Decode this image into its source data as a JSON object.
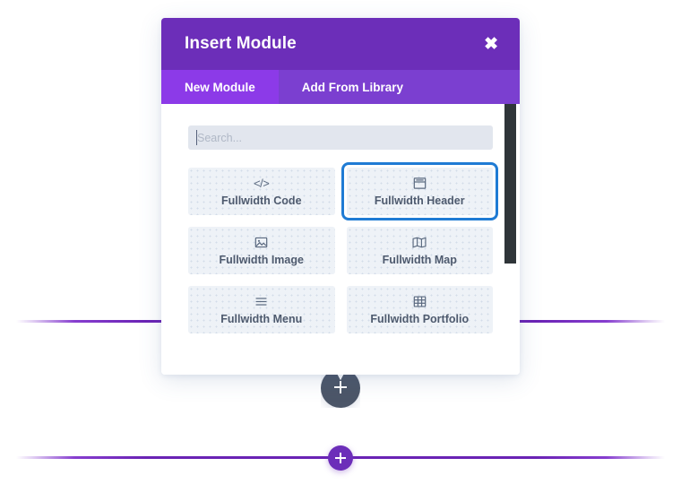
{
  "modal": {
    "title": "Insert Module",
    "close_icon": "close-icon",
    "close_glyph": "✖",
    "tabs": [
      {
        "label": "New Module",
        "active": true
      },
      {
        "label": "Add From Library",
        "active": false
      }
    ],
    "search": {
      "placeholder": "Search...",
      "value": ""
    },
    "modules": [
      {
        "label": "Fullwidth Code",
        "icon": "code-icon",
        "selected": false
      },
      {
        "label": "Fullwidth Header",
        "icon": "header-icon",
        "selected": true
      },
      {
        "label": "Fullwidth Image",
        "icon": "image-icon",
        "selected": false
      },
      {
        "label": "Fullwidth Map",
        "icon": "map-icon",
        "selected": false
      },
      {
        "label": "Fullwidth Menu",
        "icon": "menu-icon",
        "selected": false
      },
      {
        "label": "Fullwidth Portfolio",
        "icon": "portfolio-icon",
        "selected": false
      }
    ],
    "scrollbar": {
      "name": "modal-scrollbar"
    }
  },
  "canvas": {
    "section_toggle": {
      "icon": "plus-icon"
    },
    "add_section_button": {
      "icon": "plus-icon"
    }
  },
  "colors": {
    "header_purple": "#6c2eb9",
    "tabbar_purple": "#7b3fd0",
    "tab_active_purple": "#8c3ae8",
    "selection_blue": "#1f7bd4",
    "tile_bg": "#eef2f7",
    "divider_purple": "#6a23b4",
    "scrollbar_thumb": "#2f3539"
  }
}
